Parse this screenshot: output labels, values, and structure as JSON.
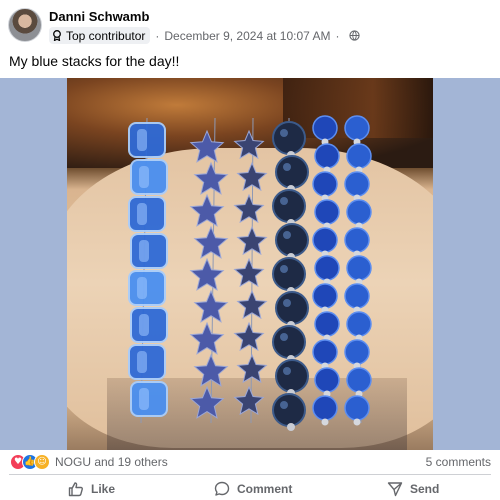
{
  "post": {
    "author": "Danni Schwamb",
    "badge": "Top contributor",
    "timestamp": "December 9, 2024 at 10:07 AM",
    "separator": "·",
    "audience_icon": "globe-icon",
    "caption": "My blue stacks for the day!!"
  },
  "photo": {
    "subject": "photo",
    "frame_color": "#a3b5d6"
  },
  "reactions": {
    "icons": [
      "love-reaction-icon",
      "like-reaction-icon",
      "care-reaction-icon"
    ],
    "summary": "NOGU and 19 others",
    "comments": "5 comments"
  },
  "actions": {
    "like": "Like",
    "comment": "Comment",
    "send": "Send"
  },
  "colors": {
    "secondary_text": "#65676b",
    "like_blue": "#1b74e4",
    "love_red": "#f33e58",
    "care_yellow": "#f7b125"
  }
}
